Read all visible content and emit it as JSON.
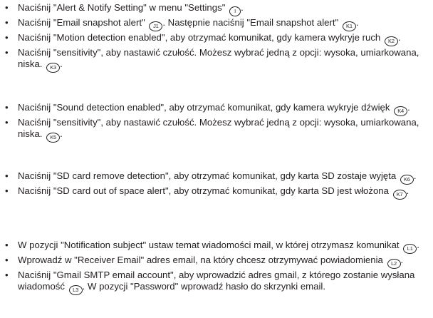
{
  "bullet": "•",
  "groups": [
    {
      "items": [
        {
          "text": "Naciśnij \"Alert & Notify Setting\" w menu \"Settings\"",
          "badge": "I",
          "after": "."
        },
        {
          "text": "Naciśnij \"Email snapshot alert\"",
          "badge": "J1",
          "after": ". Następnie naciśnij \"Email snapshot alert\"",
          "badge2": "K1",
          "after2": "."
        },
        {
          "text": "Naciśnij \"Motion detection enabled\", aby otrzymać komunikat, gdy kamera wykryje ruch",
          "badge": "K2",
          "after": "."
        },
        {
          "text": "Naciśnij \"sensitivity\", aby nastawić czułość. Możesz wybrać jedną z opcji: wysoka, umiarkowana, niska.",
          "badge": "K3",
          "after": "."
        }
      ]
    },
    {
      "items": [
        {
          "text": "Naciśnij \"Sound detection enabled\", aby otrzymać komunikat, gdy kamera wykryje dźwięk",
          "badge": "K4",
          "after": "."
        },
        {
          "text": "Naciśnij \"sensitivity\", aby nastawić czułość. Możesz wybrać jedną z opcji: wysoka, umiarkowana, niska.",
          "badge": "K5",
          "after": "."
        }
      ]
    },
    {
      "items": [
        {
          "text": "Naciśnij \"SD card remove detection\", aby otrzymać komunikat, gdy karta SD zostaje wyjęta",
          "badge": "K6",
          "after": "."
        },
        {
          "text": "Naciśnij \"SD card out of space alert\", aby otrzymać komunikat, gdy karta SD jest włożona",
          "badge": "K7",
          "after": "."
        }
      ]
    },
    {
      "items": [
        {
          "text": "W pozycji \"Notification subject\" ustaw temat wiadomości mail, w której otrzymasz komunikat",
          "badge": "L1",
          "after": "."
        },
        {
          "text": "Wprowadź w \"Receiver Email\" adres email, na który chcesz otrzymywać powiadomienia",
          "badge": "L2",
          "after": "."
        },
        {
          "text": "Naciśnij \"Gmail SMTP email account\", aby wprowadzić adres gmail, z którego zostanie wysłana wiadomość",
          "badge": "L3",
          "after": ". W pozycji \"Password\" wprowadź hasło do skrzynki email."
        }
      ]
    }
  ]
}
